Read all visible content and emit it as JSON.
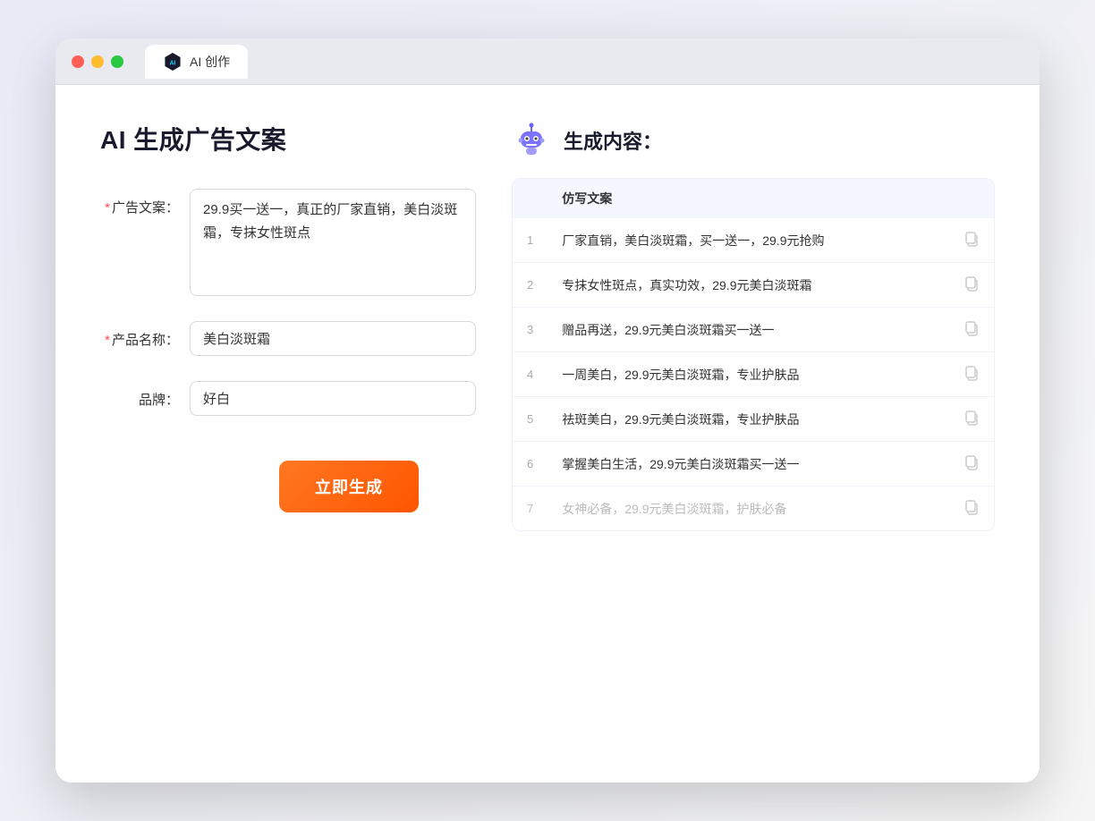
{
  "window": {
    "tab_label": "AI 创作"
  },
  "left_panel": {
    "title": "AI 生成广告文案",
    "fields": [
      {
        "id": "ad_copy",
        "label": "广告文案：",
        "required": true,
        "type": "textarea",
        "value": "29.9买一送一，真正的厂家直销，美白淡斑霜，专抹女性斑点"
      },
      {
        "id": "product_name",
        "label": "产品名称：",
        "required": true,
        "type": "input",
        "value": "美白淡斑霜"
      },
      {
        "id": "brand",
        "label": "品牌：",
        "required": false,
        "type": "input",
        "value": "好白"
      }
    ],
    "generate_btn": "立即生成"
  },
  "right_panel": {
    "title": "生成内容：",
    "table_header": "仿写文案",
    "results": [
      {
        "index": 1,
        "text": "厂家直销，美白淡斑霜，买一送一，29.9元抢购",
        "faded": false
      },
      {
        "index": 2,
        "text": "专抹女性斑点，真实功效，29.9元美白淡斑霜",
        "faded": false
      },
      {
        "index": 3,
        "text": "赠品再送，29.9元美白淡斑霜买一送一",
        "faded": false
      },
      {
        "index": 4,
        "text": "一周美白，29.9元美白淡斑霜，专业护肤品",
        "faded": false
      },
      {
        "index": 5,
        "text": "祛斑美白，29.9元美白淡斑霜，专业护肤品",
        "faded": false
      },
      {
        "index": 6,
        "text": "掌握美白生活，29.9元美白淡斑霜买一送一",
        "faded": false
      },
      {
        "index": 7,
        "text": "女神必备，29.9元美白淡斑霜，护肤必备",
        "faded": true
      }
    ]
  }
}
